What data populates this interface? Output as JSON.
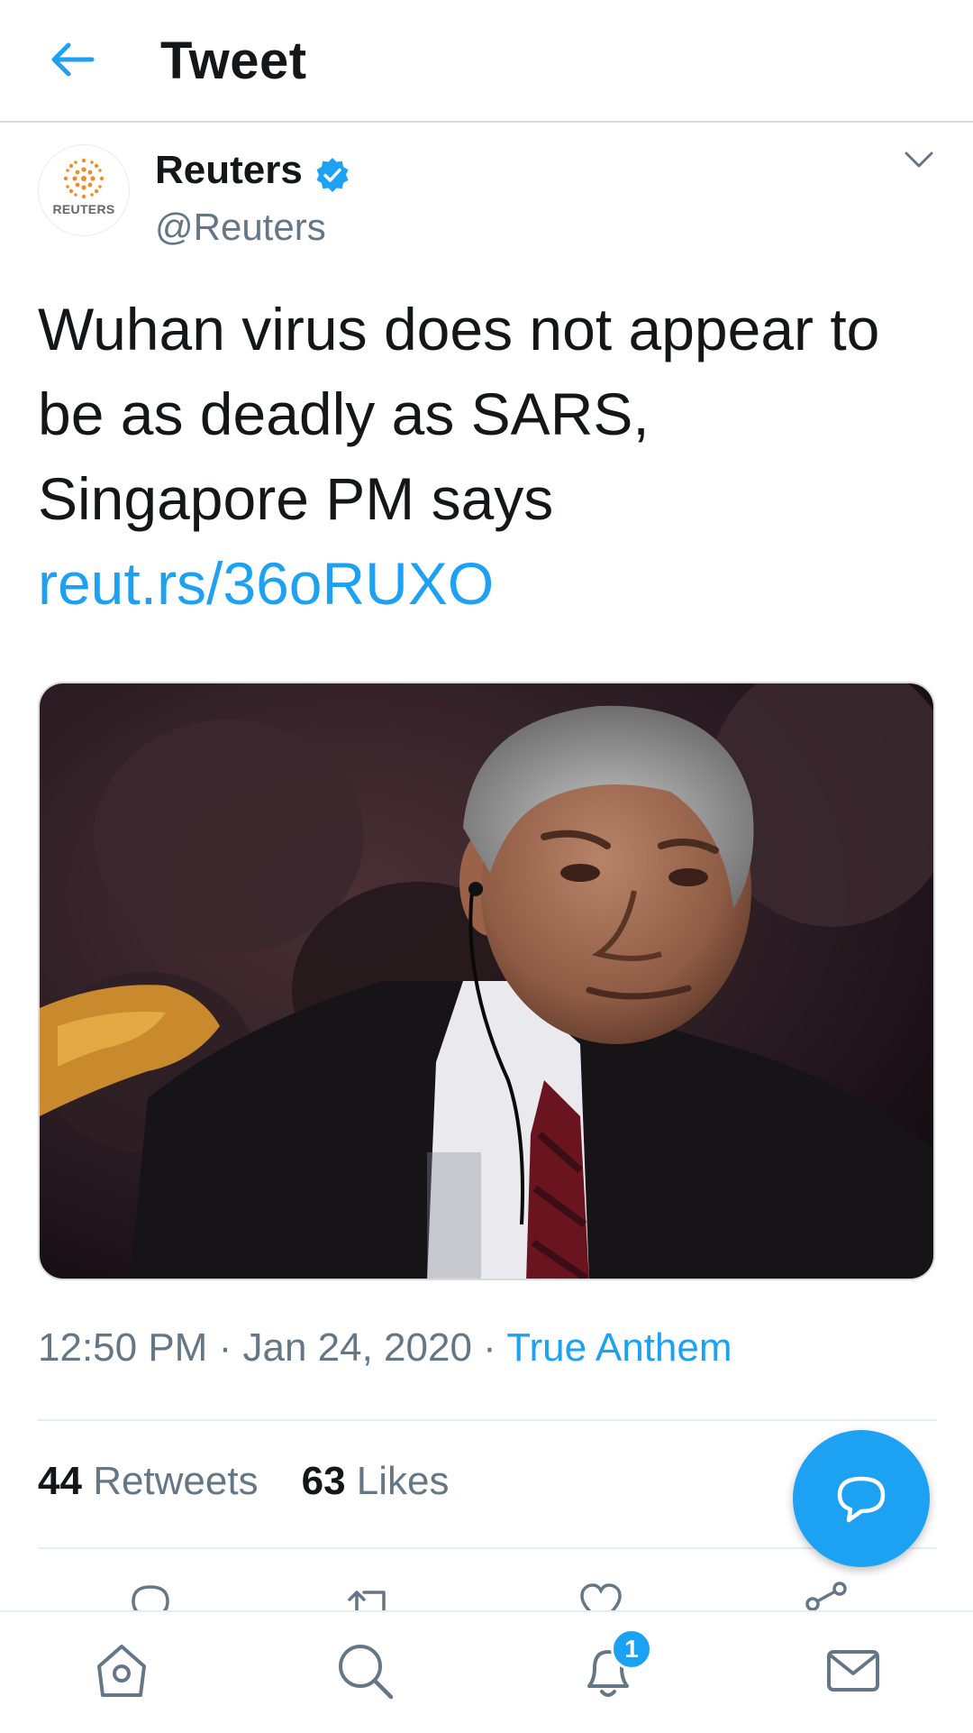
{
  "header": {
    "title": "Tweet"
  },
  "author": {
    "name": "Reuters",
    "handle": "@Reuters",
    "logo_text": "REUTERS",
    "verified": true
  },
  "tweet": {
    "text": "Wuhan virus does not appear to be as deadly as SARS, Singapore PM says",
    "link": "reut.rs/36oRUXO"
  },
  "meta": {
    "time": "12:50 PM",
    "date": "Jan 24, 2020",
    "source": "True Anthem",
    "separator": "·"
  },
  "stats": {
    "retweets_count": "44",
    "retweets_label": "Retweets",
    "likes_count": "63",
    "likes_label": "Likes"
  },
  "bottom_nav": {
    "notifications_badge": "1"
  },
  "colors": {
    "accent": "#1da1f2",
    "secondary_text": "#657786",
    "primary_text": "#14171a",
    "logo_orange": "#f28c28"
  },
  "icons": [
    "back-arrow-icon",
    "verified-badge-icon",
    "chevron-down-icon",
    "reply-icon",
    "retweet-icon",
    "like-icon",
    "share-icon",
    "compose-reply-icon",
    "home-icon",
    "search-icon",
    "bell-icon",
    "mail-icon"
  ]
}
